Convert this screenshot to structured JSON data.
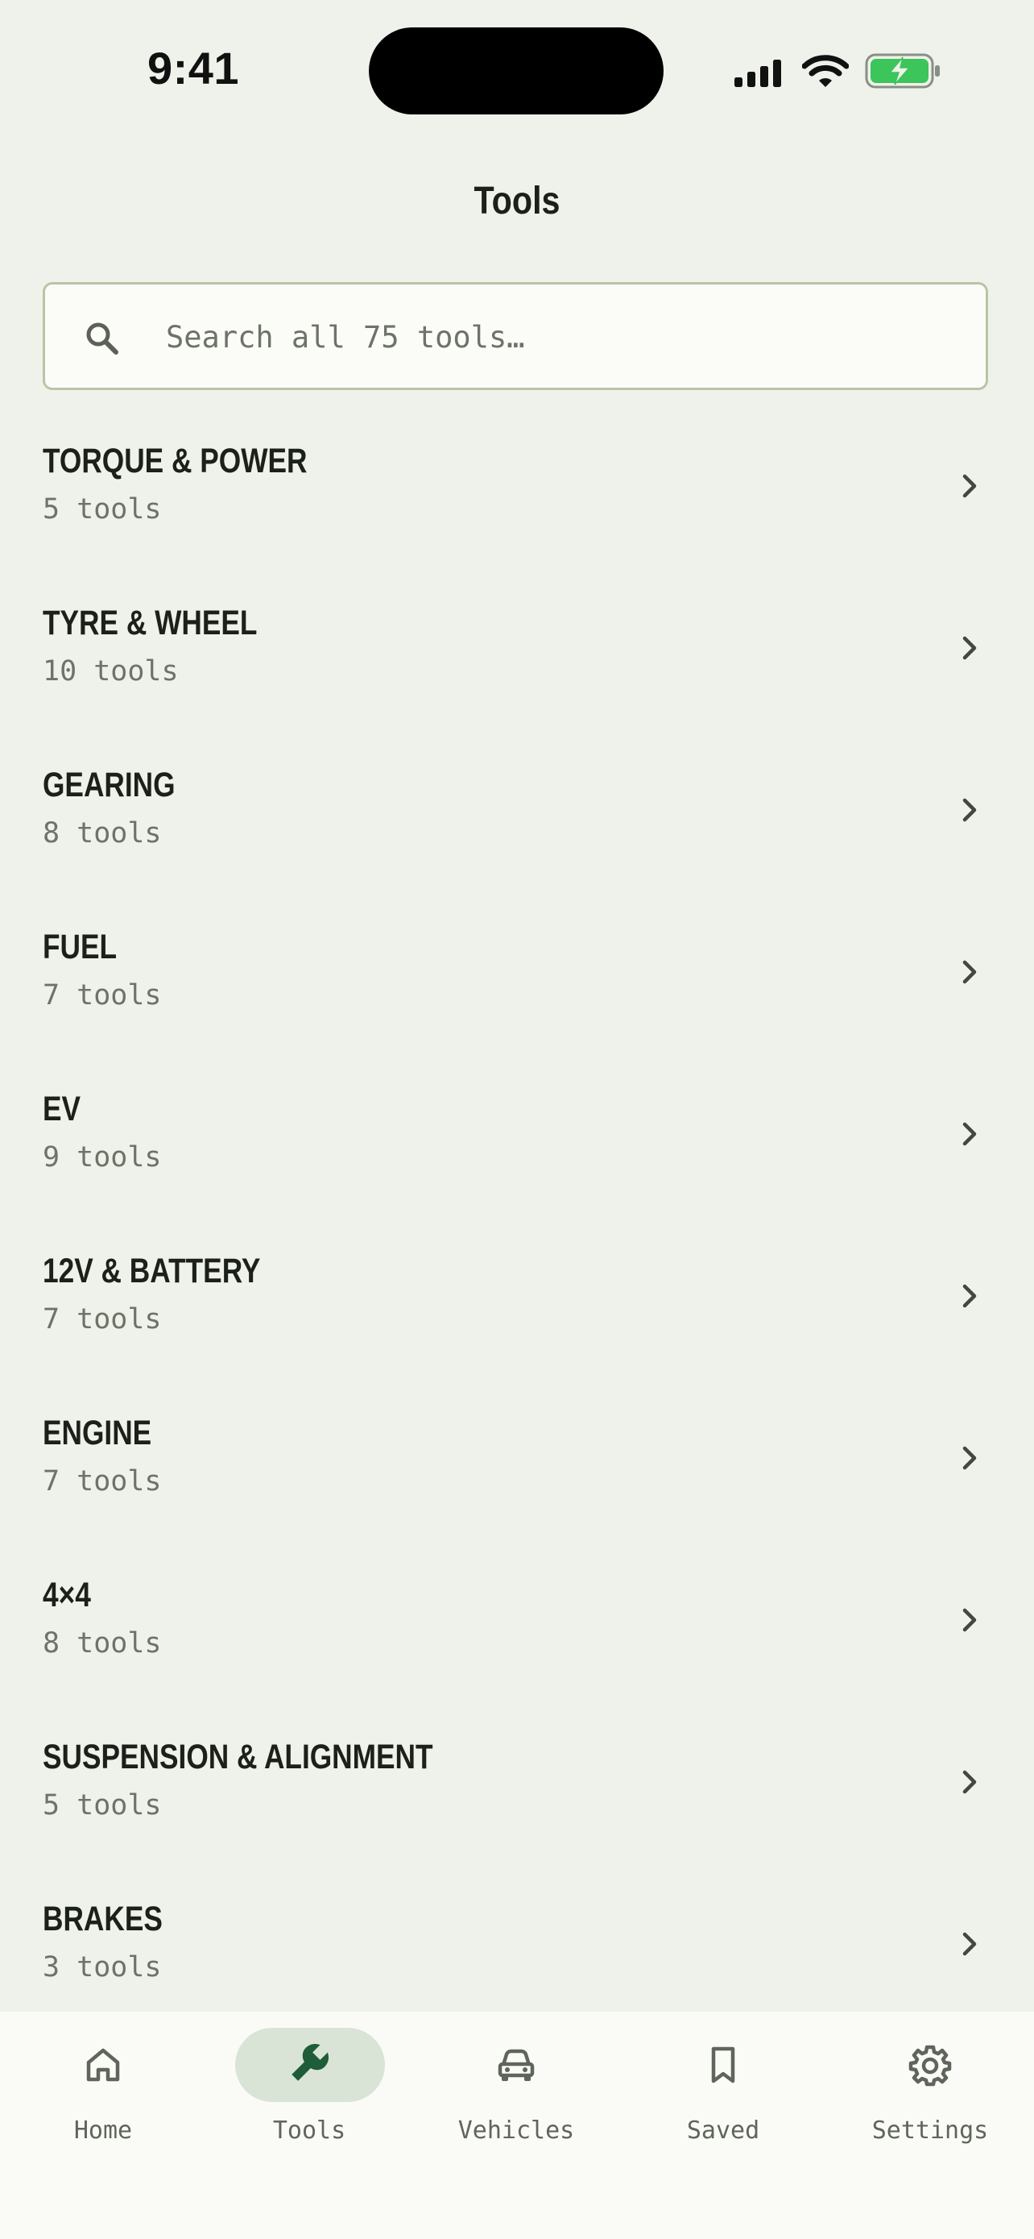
{
  "status_bar": {
    "time": "9:41",
    "battery_color": "#3cc55b"
  },
  "header": {
    "title": "Tools"
  },
  "search": {
    "placeholder": "Search all 75 tools…",
    "icon": "search-icon"
  },
  "categories": [
    {
      "name": "TORQUE & POWER",
      "count": "5 tools"
    },
    {
      "name": "TYRE & WHEEL",
      "count": "10 tools"
    },
    {
      "name": "GEARING",
      "count": "8 tools"
    },
    {
      "name": "FUEL",
      "count": "7 tools"
    },
    {
      "name": "EV",
      "count": "9 tools"
    },
    {
      "name": "12V & BATTERY",
      "count": "7 tools"
    },
    {
      "name": "ENGINE",
      "count": "7 tools"
    },
    {
      "name": "4×4",
      "count": "8 tools"
    },
    {
      "name": "SUSPENSION & ALIGNMENT",
      "count": "5 tools"
    },
    {
      "name": "BRAKES",
      "count": "3 tools"
    }
  ],
  "tab_bar": {
    "active_tab": "Tools",
    "accent_color": "#1f5c38",
    "tabs": [
      {
        "label": "Home",
        "icon": "home-icon"
      },
      {
        "label": "Tools",
        "icon": "wrench-icon"
      },
      {
        "label": "Vehicles",
        "icon": "car-icon"
      },
      {
        "label": "Saved",
        "icon": "bookmark-icon"
      },
      {
        "label": "Settings",
        "icon": "gear-icon"
      }
    ]
  }
}
